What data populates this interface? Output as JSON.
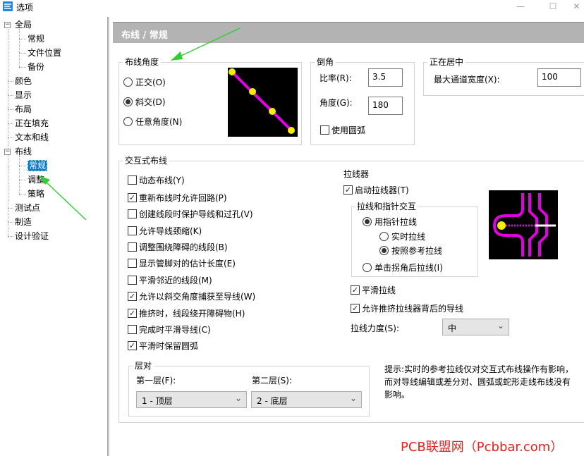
{
  "window": {
    "title": "选项",
    "buttons": {
      "minimize": "—",
      "maximize": "☐",
      "close": "✕"
    }
  },
  "tree": {
    "items": [
      {
        "label": "全局",
        "expanded": true,
        "children": [
          "常规",
          "文件位置",
          "备份"
        ]
      },
      {
        "label": "颜色"
      },
      {
        "label": "显示"
      },
      {
        "label": "布局"
      },
      {
        "label": "正在填充"
      },
      {
        "label": "文本和线"
      },
      {
        "label": "布线",
        "expanded": true,
        "children": [
          "常规",
          "调整",
          "策略"
        ],
        "selected_child": "常规"
      },
      {
        "label": "测试点"
      },
      {
        "label": "制造"
      },
      {
        "label": "设计验证"
      }
    ],
    "expand_glyph": "−"
  },
  "page_header": "布线 / 常规",
  "routing_angle": {
    "title": "布线角度",
    "options": [
      {
        "label": "正交(O)",
        "selected": false
      },
      {
        "label": "斜交(D)",
        "selected": true
      },
      {
        "label": "任意角度(N)",
        "selected": false
      }
    ]
  },
  "miter": {
    "title": "倒角",
    "ratio_label": "比率(R):",
    "ratio_value": "3.5",
    "angle_label": "角度(G):",
    "angle_value": "180",
    "use_arc_label": "使用圆弧",
    "use_arc_checked": false
  },
  "centering": {
    "title": "正在居中",
    "max_channel_label": "最大通道宽度(X):",
    "max_channel_value": "100"
  },
  "interactive": {
    "title": "交互式布线",
    "options": [
      {
        "label": "动态布线(Y)",
        "checked": false
      },
      {
        "label": "重新布线时允许回路(P)",
        "checked": true
      },
      {
        "label": "创建线段时保护导线和过孔(V)",
        "checked": false
      },
      {
        "label": "允许导线颈缩(K)",
        "checked": false
      },
      {
        "label": "调整围绕障碍的线段(B)",
        "checked": false
      },
      {
        "label": "显示管脚对的估计长度(E)",
        "checked": false
      },
      {
        "label": "平滑邻近的线段(M)",
        "checked": false
      },
      {
        "label": "允许以斜交角度捕获至导线(W)",
        "checked": true
      },
      {
        "label": "推挤时，线段绕开障碍物(H)",
        "checked": true
      },
      {
        "label": "完成时平滑导线(C)",
        "checked": false
      },
      {
        "label": "平滑时保留圆弧",
        "checked": true
      }
    ]
  },
  "layer_pair": {
    "title": "层对",
    "first_label": "第一层(F):",
    "first_value": "1 - 顶层",
    "second_label": "第二层(S):",
    "second_value": "2 - 底层"
  },
  "rubberband": {
    "title": "拉线器",
    "enable_label": "启动拉线器(T)",
    "enable_checked": true,
    "cross_title": "拉线和指针交互",
    "use_pointer_label": "用指针拉线",
    "use_pointer_selected": true,
    "realtime_label": "实时拉线",
    "realtime_selected": false,
    "reference_label": "按照参考拉线",
    "reference_selected": true,
    "click_corner_label": "单击拐角后拉线(I)",
    "click_corner_selected": false,
    "smooth_label": "平滑拉线",
    "smooth_checked": true,
    "allow_push_label": "允许推挤拉线器背后的导线",
    "allow_push_checked": true,
    "strength_label": "拉线力度(S):",
    "strength_value": "中"
  },
  "hint": "提示:实时的参考拉线仅对交互式布线操作有影响，而对导线编辑或差分对、圆弧或蛇形走线布线没有影响。",
  "watermark": "PCB联盟网（Pcbbar.com）",
  "icons": {
    "app": "app-icon",
    "dropdown": "chevron-down-icon",
    "check": "✓"
  },
  "colors": {
    "header_band": "#b3b3b3",
    "selection": "#0078d7",
    "trace": "#e000e0",
    "pad": "#f0f000",
    "annotation_arrow": "#33cc33",
    "watermark": "#e3231d"
  }
}
